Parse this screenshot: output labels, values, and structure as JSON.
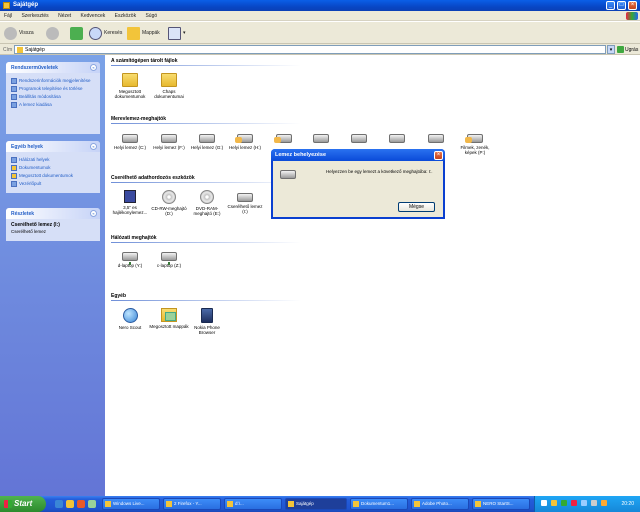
{
  "window": {
    "title": "Sajátgép"
  },
  "menubar": [
    "Fájl",
    "Szerkesztés",
    "Nézet",
    "Kedvencek",
    "Eszközök",
    "Súgó"
  ],
  "toolbar": {
    "back": "Vissza",
    "search": "Keresés",
    "folders": "Mappák"
  },
  "address": {
    "label": "Cím",
    "value": "Sajátgép",
    "go": "Ugrás"
  },
  "sidebar": {
    "system_tasks": {
      "title": "Rendszerműveletek",
      "items": [
        "Rendszerinformációk megjelenítése",
        "Programok telepítése és törlése",
        "Beállítás módosítása",
        "A lemez kiadása"
      ]
    },
    "other_places": {
      "title": "Egyéb helyek",
      "items": [
        "Hálózati helyek",
        "Dokumentumok",
        "Megosztott dokumentumok",
        "Vezérlőpult"
      ]
    },
    "details": {
      "title": "Részletek",
      "name": "Cserélhető lemez (I:)",
      "type": "Cserélhető lemez"
    }
  },
  "groups": {
    "files": {
      "title": "A számítógépen tárolt fájlok",
      "items": [
        "Megosztott dokumentumok",
        "Chaps dokumentumai"
      ]
    },
    "hard_drives": {
      "title": "Merevlemez-meghajtók",
      "items": [
        "Helyi lemez (C:)",
        "Helyi lemez (F:)",
        "Helyi lemez (G:)",
        "Helyi lemez (H:)",
        "Filmek, zenék, képek (P:)"
      ]
    },
    "removable": {
      "title": "Cserélhető adathordozós eszközök",
      "items": [
        "3,5\" es hajlékonylemez...",
        "CD-RW-meghajtó (D:)",
        "DVD-RAM-meghajtó (E:)",
        "Cserélhető lemez (I:)"
      ]
    },
    "network": {
      "title": "Hálózati meghajtók",
      "items": [
        "d-laptop (Y:)",
        "c-laptop (Z:)"
      ]
    },
    "other": {
      "title": "Egyéb",
      "items": [
        "Nero Scout",
        "Megosztott mappák",
        "Nokia Phone Browser"
      ]
    }
  },
  "dialog": {
    "title": "Lemez behelyezése",
    "message": "Helyezzen be egy lemezt a következő meghajtóba: I:.",
    "ok": "Mégse"
  },
  "taskbar": {
    "start": "Start",
    "tasks": [
      "Windows Live...",
      "2 Firefox - Y...",
      "d:\\...",
      "Sajátgép",
      "Dokumentum1...",
      "Adobe Photo...",
      "NERO StartS..."
    ],
    "clock": "20:20"
  },
  "colors": {
    "accent": "#215dc6",
    "titlebar": "#0a4ad8",
    "sidebar": "#7ba2e7",
    "start": "#3a9a3a"
  }
}
